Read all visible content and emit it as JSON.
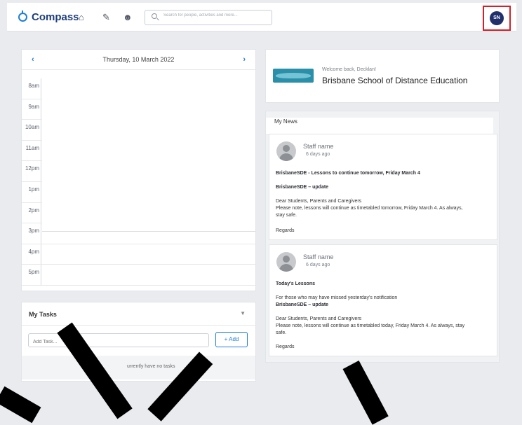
{
  "topbar": {
    "app_name": "Compass",
    "search_placeholder": "Search for people, activities and more...",
    "avatar_initials": "SN"
  },
  "calendar": {
    "date": "Thursday, 10 March 2022",
    "prev": "‹",
    "next": "›",
    "hours": [
      "8am",
      "9am",
      "10am",
      "11am",
      "12pm",
      "1pm",
      "2pm",
      "3pm",
      "4pm",
      "5pm"
    ]
  },
  "tasks": {
    "title": "My Tasks",
    "input_placeholder": "Add Task...",
    "add_label": "+ Add",
    "empty_text": "urrently have no tasks"
  },
  "school": {
    "welcome": "Welcome back, Decklan!",
    "name": "Brisbane School of Distance Education"
  },
  "news": {
    "title": "My News",
    "items": [
      {
        "author": "Staff name",
        "time": "6 days ago",
        "headline": "BrisbaneSDE - Lessons to continue tomorrow, Friday March 4",
        "subhead": "BrisbaneSDE – update",
        "greeting": "Dear Students, Parents and Caregivers",
        "body1": "Please note, lessons will continue as timetabled tomorrow, Friday March 4. As always,",
        "body2": "stay safe.",
        "signoff": "Regards"
      },
      {
        "author": "Staff name",
        "time": "6 days ago",
        "headline": "Today's Lessons",
        "line1": "For those who may have missed yesterday's notification",
        "subhead": "BrisbaneSDE – update",
        "greeting": "Dear Students, Parents and Caregivers",
        "body1": "Please note, lessons will continue as timetabled today, Friday March 4. As always, stay",
        "body2": "safe.",
        "signoff": "Regards"
      }
    ]
  }
}
